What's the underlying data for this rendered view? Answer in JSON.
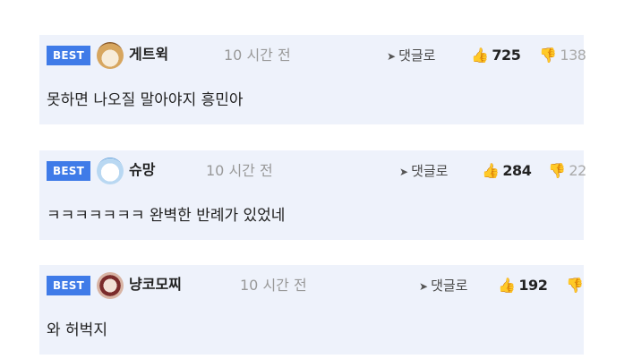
{
  "comments": [
    {
      "badge": "BEST",
      "author": "게트윅",
      "time": "10 시간 전",
      "reply_label": "댓글로",
      "likes": "725",
      "dislikes": "138",
      "avatar_icon": "fox-avatar",
      "text": "못하면 나오질 말아야지 흥민아"
    },
    {
      "badge": "BEST",
      "author": "슈망",
      "time": "10 시간 전",
      "reply_label": "댓글로",
      "likes": "284",
      "dislikes": "22",
      "avatar_icon": "white-dog-avatar",
      "text": "ㅋㅋㅋㅋㅋㅋㅋ 완벽한 반례가 있었네"
    },
    {
      "badge": "BEST",
      "author": "냥코모찌",
      "time": "10 시간 전",
      "reply_label": "댓글로",
      "likes": "192",
      "dislikes": "",
      "avatar_icon": "masked-face-avatar",
      "text": "와 허벅지"
    }
  ],
  "colors": {
    "badge_bg": "#3f7be8",
    "comment_bg": "#eef2fb",
    "muted_text": "#999999"
  }
}
